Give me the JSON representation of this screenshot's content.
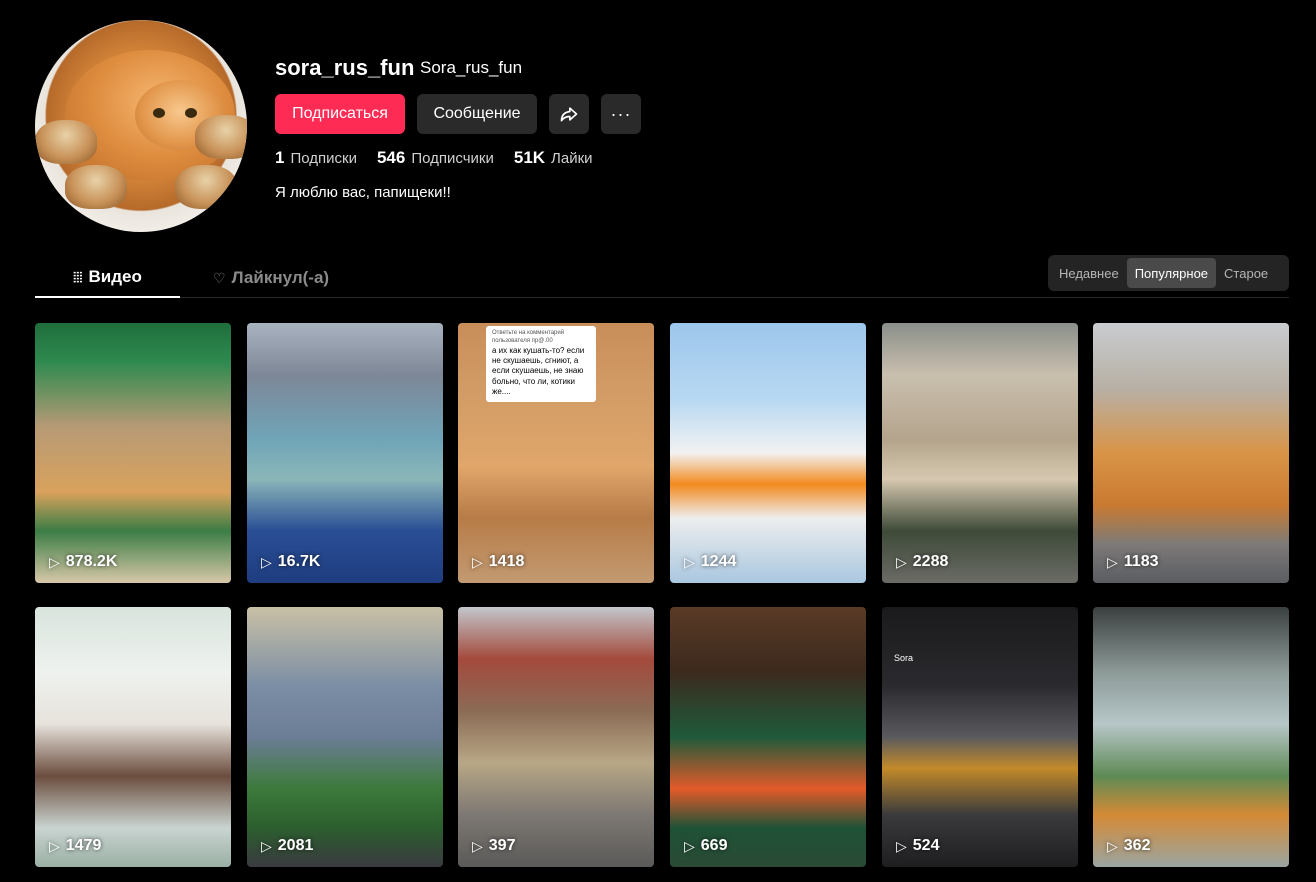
{
  "profile": {
    "username": "sora_rus_fun",
    "nickname": "Sora_rus_fun",
    "bio": "Я люблю вас, папищеки!!"
  },
  "actions": {
    "follow": "Подписаться",
    "message": "Сообщение",
    "share_icon": "share-icon",
    "more": "···"
  },
  "stats": [
    {
      "value": "1",
      "label": "Подписки"
    },
    {
      "value": "546",
      "label": "Подписчики"
    },
    {
      "value": "51K",
      "label": "Лайки"
    }
  ],
  "tabs": {
    "videos": "Видео",
    "liked": "Лайкнул(-а)"
  },
  "sort": {
    "options": [
      "Недавнее",
      "Популярное",
      "Старое"
    ],
    "selected": "Популярное"
  },
  "videos": [
    {
      "views": "878.2K"
    },
    {
      "views": "16.7K"
    },
    {
      "views": "1418",
      "overlay_header": "Ответьте на комментарий пользователя пр@.00",
      "overlay_text": "а их как кушать-то? если не скушаешь, сгниют, а если скушаешь, не знаю больно, что ли, котики же...."
    },
    {
      "views": "1244"
    },
    {
      "views": "2288"
    },
    {
      "views": "1183"
    },
    {
      "views": "1479"
    },
    {
      "views": "2081"
    },
    {
      "views": "397"
    },
    {
      "views": "669"
    },
    {
      "views": "524",
      "badge": "Sora"
    },
    {
      "views": "362"
    }
  ],
  "colors": {
    "accent": "#fe2c55",
    "button_bg": "#2a2a2a",
    "background": "#000000"
  }
}
